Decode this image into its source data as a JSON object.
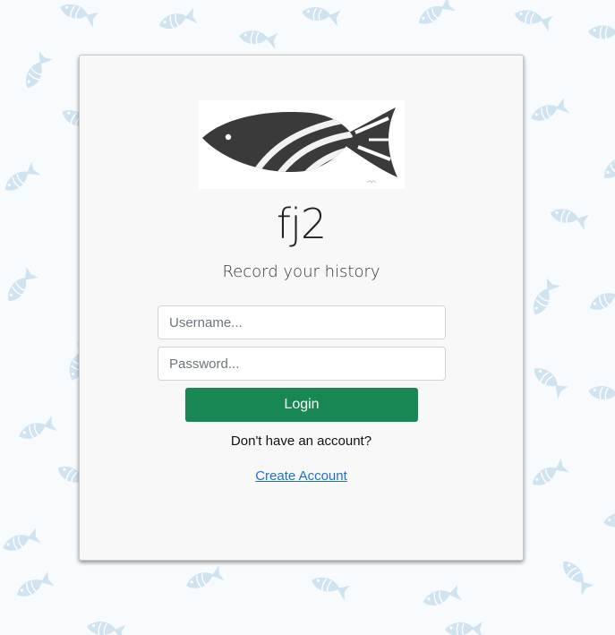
{
  "app": {
    "name": "fj2",
    "tagline": "Record your history",
    "logo_icon": "striped-fish-icon",
    "background_icon": "fish-pattern-icon"
  },
  "login_form": {
    "username_placeholder": "Username...",
    "username_value": "",
    "password_placeholder": "Password...",
    "password_value": "",
    "login_label": "Login",
    "no_account_text": "Don't have an account?",
    "create_account_label": "Create Account"
  },
  "colors": {
    "background": "#f7fbfd",
    "fish_pattern": "#cfe3f1",
    "card": "#f8f8f8",
    "login_button": "#198754",
    "link": "#1d6fd8"
  }
}
